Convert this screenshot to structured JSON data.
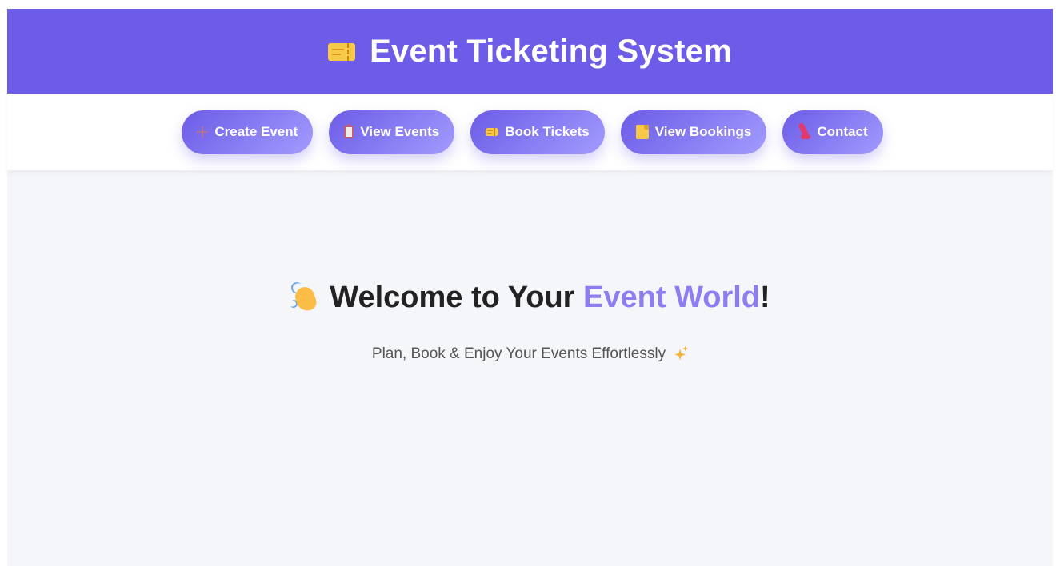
{
  "header": {
    "title": "Event Ticketing System",
    "icon": "ticket-icon"
  },
  "nav": {
    "items": [
      {
        "label": "Create Event",
        "icon": "plus-icon"
      },
      {
        "label": "View Events",
        "icon": "clipboard-icon"
      },
      {
        "label": "Book Tickets",
        "icon": "ticket-icon"
      },
      {
        "label": "View Bookings",
        "icon": "memo-icon"
      },
      {
        "label": "Contact",
        "icon": "phone-icon"
      }
    ]
  },
  "hero": {
    "title_prefix": "Welcome to Your ",
    "title_accent": "Event World",
    "title_suffix": "!",
    "subtitle": "Plan, Book & Enjoy Your Events Effortlessly",
    "title_icon": "waving-hand-icon",
    "subtitle_icon": "sparkles-icon"
  },
  "colors": {
    "primary": "#6c5ce7",
    "accent_text": "#8c7df0",
    "background": "#f5f6fa"
  }
}
